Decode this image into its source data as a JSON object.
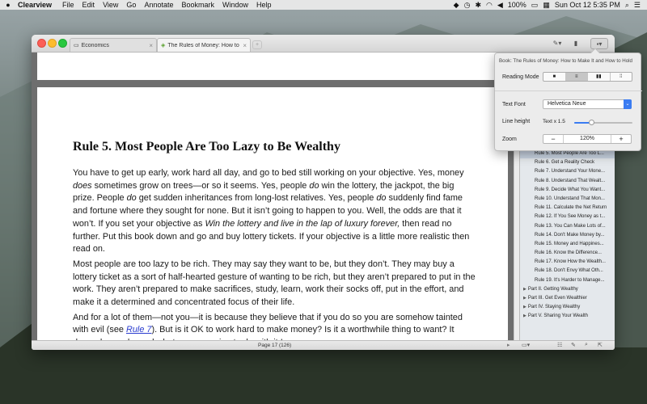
{
  "menubar": {
    "app_name": "Clearview",
    "items": [
      "File",
      "Edit",
      "View",
      "Go",
      "Annotate",
      "Bookmark",
      "Window",
      "Help"
    ],
    "battery": "100%",
    "clock": "Sun Oct 12  5:35 PM"
  },
  "tabs": [
    {
      "label": "Economics",
      "icon": "folder-icon"
    },
    {
      "label": "The Rules of Money: How to M",
      "icon": "book-icon"
    }
  ],
  "document": {
    "heading": "Rule 5. Most People Are Too Lazy to Be Wealthy",
    "p1": {
      "a": "You have to get up early, work hard all day, and go to bed still working on your objective. Yes, money ",
      "b": "does",
      "c": " sometimes grow on trees—or so it seems. Yes, people ",
      "d": "do",
      "e": " win the lottery, the jackpot, the big prize. People ",
      "f": "do",
      "g": " get sudden inheritances from long-lost relatives. Yes, people ",
      "h": "do",
      "i": " suddenly find fame and fortune where they sought for none. But it isn’t going to happen to you. Well, the odds are that it won’t. If you set your objective as ",
      "j": "Win the lottery and live in the lap of luxury forever,",
      "k": " then read no further. Put this book down and go and buy lottery tickets. If your objective is a little more realistic then read on."
    },
    "p2": "Most people are too lazy to be rich. They may say they want to be, but they don’t. They may buy a lottery ticket as a sort of half-hearted gesture of wanting to be rich, but they aren’t prepared to put in the work. They aren’t prepared to make sacrifices, study, learn, work their socks off, put in the effort, and make it a determined and concentrated focus of their life.",
    "p3": {
      "a": "And for a lot of them—not you—it is because they believe that if you do so you are somehow tainted with evil (see ",
      "link": "Rule 7",
      "b": "). But is it OK to work hard to make money? Is it a worthwhile thing to want? It depends on why and what you are going to do with it I guess."
    }
  },
  "statusbar": {
    "page": "Page 17 (126)"
  },
  "sidebar": {
    "toc": [
      {
        "label": "Rule 5.  Most People Are Too L...",
        "type": "sub",
        "selected": true
      },
      {
        "label": "Rule 6.  Get a Reality Check",
        "type": "sub"
      },
      {
        "label": "Rule 7.  Understand Your Mone...",
        "type": "sub"
      },
      {
        "label": "Rule 8.  Understand That Wealt...",
        "type": "sub"
      },
      {
        "label": "Rule 9.  Decide What You Want...",
        "type": "sub"
      },
      {
        "label": "Rule 10.  Understand That Mon...",
        "type": "sub"
      },
      {
        "label": "Rule 11.  Calculate the Net Return",
        "type": "sub"
      },
      {
        "label": "Rule 12.  If You See Money as t...",
        "type": "sub"
      },
      {
        "label": "Rule 13.  You Can Make Lots of...",
        "type": "sub"
      },
      {
        "label": "Rule 14.  Don't Make Money by...",
        "type": "sub"
      },
      {
        "label": "Rule 15.  Money and Happines...",
        "type": "sub"
      },
      {
        "label": "Rule 16.  Know the Difference...",
        "type": "sub"
      },
      {
        "label": "Rule 17.  Know How the Wealth...",
        "type": "sub"
      },
      {
        "label": "Rule 18.  Don't Envy What Oth...",
        "type": "sub"
      },
      {
        "label": "Rule 19.  It's Harder to Manage...",
        "type": "sub"
      },
      {
        "label": "Part II. Getting Wealthy",
        "type": "part"
      },
      {
        "label": "Part III. Get Even Wealthier",
        "type": "part"
      },
      {
        "label": "Part IV. Staying Wealthy",
        "type": "part"
      },
      {
        "label": "Part V. Sharing Your Wealth",
        "type": "part"
      }
    ]
  },
  "popover": {
    "title": "Book: The Rules of Money: How to Make It and How to Hold",
    "reading_mode_label": "Reading Mode",
    "reading_modes": [
      "■",
      "≡",
      "▮▮",
      "⁞⁞"
    ],
    "active_mode": 1,
    "text_font_label": "Text Font",
    "text_font_value": "Helvetica Neue",
    "line_height_label": "Line height",
    "line_height_value": "Text x 1.5",
    "line_height_fraction": 0.3,
    "zoom_label": "Zoom",
    "zoom_minus": "−",
    "zoom_value": "120%",
    "zoom_plus": "+"
  }
}
